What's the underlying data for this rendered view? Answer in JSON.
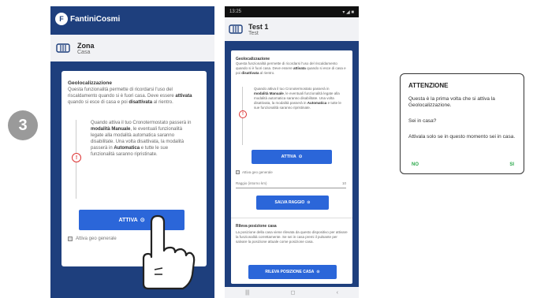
{
  "step": {
    "number": "3"
  },
  "brand": {
    "logo_letters": "F",
    "name": "FantiniCosmi"
  },
  "phone1": {
    "header": {
      "title": "Zona",
      "subtitle": "Casa",
      "icon_label": "MAISON"
    },
    "card": {
      "geo_title": "Geolocalizzazione",
      "geo_intro_1": "Questa funzionalità permette di ricordarsi l'uso del riscaldamento quando si è fuori casa. Deve essere ",
      "geo_intro_bold_1": "attivata",
      "geo_intro_2": " quando si esce di casa e poi ",
      "geo_intro_bold_2": "disattivata",
      "geo_intro_3": " al rientro.",
      "warn_1": "Quando attiva il tuo Cronotermostato passerà in ",
      "warn_bold_1": "modalità Manuale",
      "warn_2": ", le eventuali funzionalità legate alla modalità automatica saranno disabilitate. Una volta disattivata, la modalità passerà in ",
      "warn_bold_2": "Automatica",
      "warn_3": " e tutte le sue funzionalità saranno ripristinate.",
      "attiva_label": "ATTIVA",
      "check_label": "Attiva geo generale"
    }
  },
  "phone2": {
    "status": {
      "time": "13:25",
      "icons": "▾ ◢ ■"
    },
    "header": {
      "title": "Test 1",
      "subtitle": "Test"
    },
    "card": {
      "geo_title": "Geolocalizzazione",
      "geo_intro_1": "Questa funzionalità permette di ricordarsi l'uso del riscaldamento quando si è fuori casa. Deve essere ",
      "geo_intro_bold_1": "attivata",
      "geo_intro_2": " quando si esce di casa e poi ",
      "geo_intro_bold_2": "disattivata",
      "geo_intro_3": " al rientro.",
      "warn_1": "Quando attiva il tuo Cronotermostato passerà in ",
      "warn_bold_1": "modalità Manuale",
      "warn_2": ", le eventuali funzionalità legate alla modalità automatica saranno disabilitate. Una volta disattivata, la modalità passerà in ",
      "warn_bold_2": "Automatica",
      "warn_3": " e tutte le sue funzionalità saranno ripristinate.",
      "attiva_label": "ATTIVA",
      "check_label": "Attiva geo generale",
      "radius_label": "Raggio (intorno km)",
      "radius_value": "10",
      "salva_label": "SALVA RAGGIO",
      "rileva_title": "Rileva posizione casa",
      "rileva_text": "La posizione della casa viene rilevata da questo dispositivo per attivare la funzionalità correttamente. Se sei in casa premi il pulsante per salvare la posizione attuale come posizione casa.",
      "rileva_label": "RILEVA POSIZIONE CASA"
    },
    "navbar": {
      "items": [
        "|||",
        "◻",
        "‹"
      ]
    }
  },
  "dialog": {
    "title": "ATTENZIONE",
    "p1": "Questa è la prima volta che si attiva la Geolocalizzazione.",
    "p2": "Sei in casa?",
    "p3": "Attivala solo se in questo momento sei in casa.",
    "no_label": "NO",
    "si_label": "SI"
  },
  "colors": {
    "primary_blue": "#2b66d9",
    "brand_navy": "#1e3f7d",
    "warning_red": "#d33333",
    "dialog_action_green": "#2aa84a"
  },
  "icons": [
    "radiator-icon",
    "warning-icon",
    "location-icon",
    "pointing-hand-icon"
  ]
}
